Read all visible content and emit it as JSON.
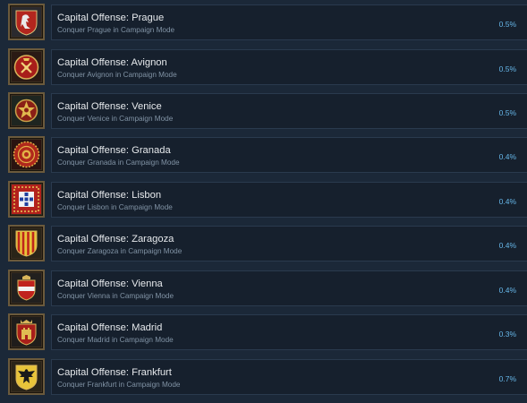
{
  "achievements": [
    {
      "title": "Capital Offense: Prague",
      "description": "Conquer Prague in Campaign Mode",
      "percent": "0.5%",
      "icon": "prague-lion-crest-icon"
    },
    {
      "title": "Capital Offense: Avignon",
      "description": "Conquer Avignon in Campaign Mode",
      "percent": "0.5%",
      "icon": "avignon-papal-crest-icon"
    },
    {
      "title": "Capital Offense: Venice",
      "description": "Conquer Venice in Campaign Mode",
      "percent": "0.5%",
      "icon": "venice-crest-icon"
    },
    {
      "title": "Capital Offense: Granada",
      "description": "Conquer Granada in Campaign Mode",
      "percent": "0.4%",
      "icon": "granada-crest-icon"
    },
    {
      "title": "Capital Offense: Lisbon",
      "description": "Conquer Lisbon in Campaign Mode",
      "percent": "0.4%",
      "icon": "lisbon-crest-icon"
    },
    {
      "title": "Capital Offense: Zaragoza",
      "description": "Conquer Zaragoza in Campaign Mode",
      "percent": "0.4%",
      "icon": "zaragoza-stripes-crest-icon"
    },
    {
      "title": "Capital Offense: Vienna",
      "description": "Conquer Vienna in Campaign Mode",
      "percent": "0.4%",
      "icon": "vienna-crest-icon"
    },
    {
      "title": "Capital Offense: Madrid",
      "description": "Conquer Madrid in Campaign Mode",
      "percent": "0.3%",
      "icon": "madrid-castle-crest-icon"
    },
    {
      "title": "Capital Offense: Frankfurt",
      "description": "Conquer Frankfurt in Campaign Mode",
      "percent": "0.7%",
      "icon": "frankfurt-eagle-crest-icon"
    }
  ]
}
